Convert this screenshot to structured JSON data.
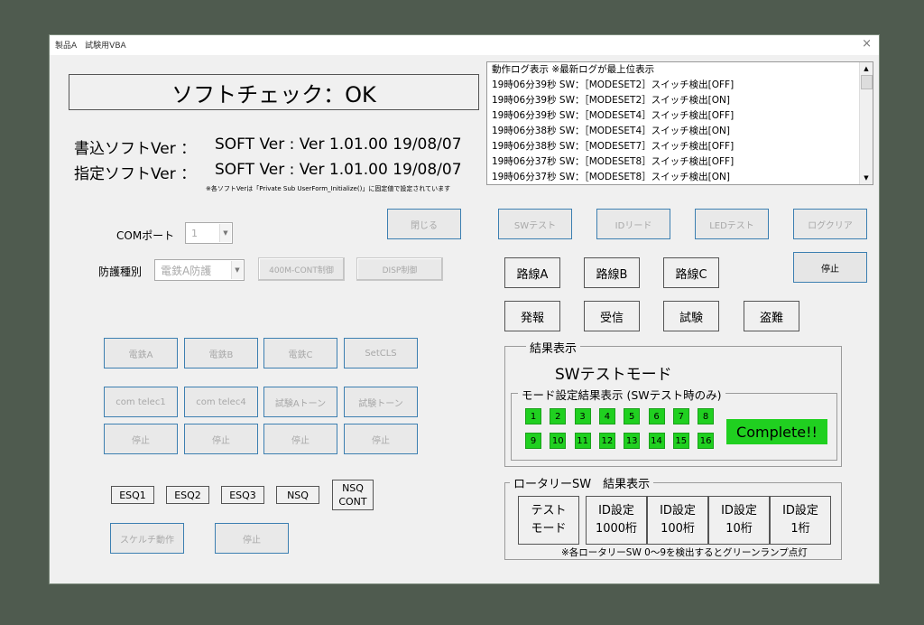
{
  "window": {
    "title": "製品A　試験用VBA",
    "close": "×"
  },
  "status": {
    "text": "ソフトチェック：OK"
  },
  "versions": {
    "write_label": "書込ソフトVer ：",
    "write_value": "SOFT Ver : Ver 1.01.00 19/08/07",
    "spec_label": "指定ソフトVer ：",
    "spec_value": "SOFT Ver : Ver 1.01.00 19/08/07",
    "note": "※各ソフトVerは「Private Sub UserForm_Initialize()」に固定値で設定されています"
  },
  "log": {
    "lines": [
      "動作ログ表示 ※最新ログが最上位表示",
      "19時06分39秒 SW：［MODESET2］スイッチ検出[OFF]",
      "19時06分39秒 SW：［MODESET2］スイッチ検出[ON]",
      "19時06分39秒 SW：［MODESET4］スイッチ検出[OFF]",
      "19時06分38秒 SW：［MODESET4］スイッチ検出[ON]",
      "19時06分38秒 SW：［MODESET7］スイッチ検出[OFF]",
      "19時06分37秒 SW：［MODESET8］スイッチ検出[OFF]",
      "19時06分37秒 SW：［MODESET8］スイッチ検出[ON]"
    ]
  },
  "com": {
    "label": "COMポート",
    "value": "1"
  },
  "protect": {
    "label": "防護種別",
    "value": "電鉄A防護",
    "btn_400m": "400M-CONT制御",
    "btn_disp": "DISP制御"
  },
  "buttons": {
    "close": "閉じる",
    "sw_test": "SWテスト",
    "id_read": "IDリード",
    "led_test": "LEDテスト",
    "log_clear": "ログクリア",
    "stop_main": "停止"
  },
  "routes": [
    "路線A",
    "路線B",
    "路線C"
  ],
  "actions": [
    "発報",
    "受信",
    "試験",
    "盗難"
  ],
  "railway": [
    "電鉄A",
    "電鉄B",
    "電鉄C",
    "SetCLS"
  ],
  "telec": [
    "com telec1",
    "com telec4",
    "試験Aトーン",
    "試験トーン"
  ],
  "telec_stop": [
    "停止",
    "停止",
    "停止",
    "停止"
  ],
  "esq": [
    "ESQ1",
    "ESQ2",
    "ESQ3",
    "NSQ"
  ],
  "nsq_cont": [
    "NSQ",
    "CONT"
  ],
  "squelch": {
    "run": "スケルチ動作",
    "stop": "停止"
  },
  "result": {
    "caption": "結果表示",
    "mode": "SWテストモード",
    "mode_caption": "モード設定結果表示 (SWテスト時のみ)",
    "lamps_row1": [
      "1",
      "2",
      "3",
      "4",
      "5",
      "6",
      "7",
      "8"
    ],
    "lamps_row2": [
      "9",
      "10",
      "11",
      "12",
      "13",
      "14",
      "15",
      "16"
    ],
    "complete": "Complete!!",
    "lamp_color": "#20d020"
  },
  "rotary": {
    "caption": "ロータリーSW　結果表示",
    "cells": [
      {
        "l1": "テスト",
        "l2": "モード"
      },
      {
        "l1": "ID設定",
        "l2": "1000桁"
      },
      {
        "l1": "ID設定",
        "l2": "100桁"
      },
      {
        "l1": "ID設定",
        "l2": "10桁"
      },
      {
        "l1": "ID設定",
        "l2": "1桁"
      }
    ],
    "note": "※各ロータリーSW 0～9を検出するとグリーンランプ点灯"
  }
}
